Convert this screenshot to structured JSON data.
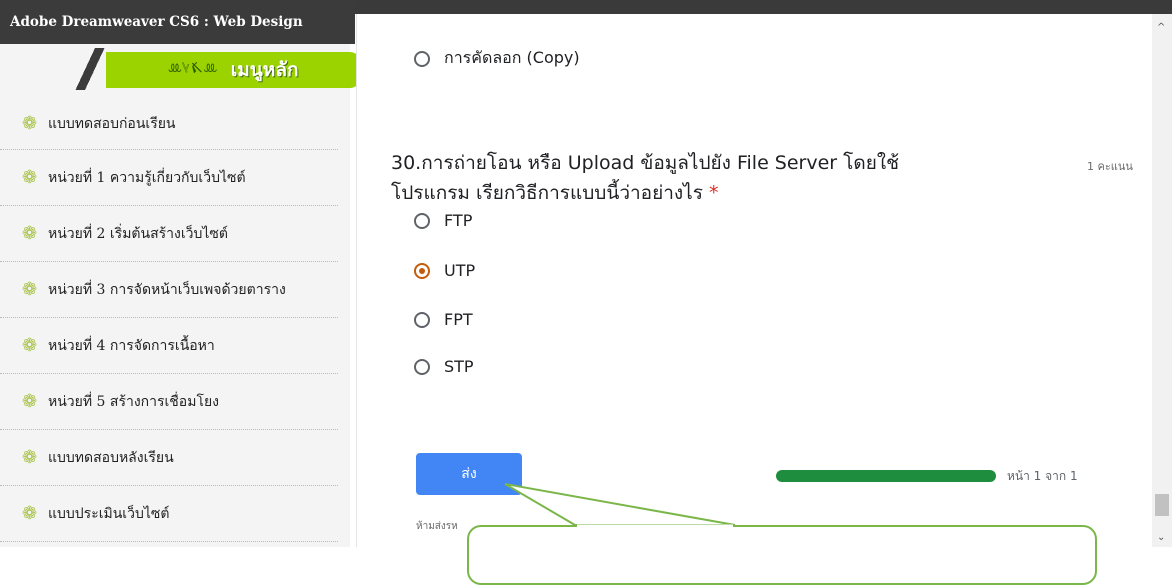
{
  "site_title": "Adobe Dreamweaver CS6 : Web Design",
  "menu": {
    "header_label": "เมนูหลัก",
    "header_decoration": "ꔛ𐇢𐆜ꔛ",
    "items": [
      {
        "label": "แบบทดสอบก่อนเรียน"
      },
      {
        "label": "หน่วยที่ 1 ความรู้เกี่ยวกับเว็บไซต์"
      },
      {
        "label": "หน่วยที่ 2 เริ่มต้นสร้างเว็บไซต์"
      },
      {
        "label": "หน่วยที่ 3 การจัดหน้าเว็บเพจด้วยตาราง"
      },
      {
        "label": "หน่วยที่ 4 การจัดการเนื้อหา"
      },
      {
        "label": "หน่วยที่ 5 สร้างการเชื่อมโยง"
      },
      {
        "label": "แบบทดสอบหลังเรียน"
      },
      {
        "label": "แบบประเมินเว็บไซต์"
      }
    ],
    "item_icon": "flower-icon"
  },
  "form": {
    "previous_option": "การคัดลอก (Copy)",
    "question_line1": "30.การถ่ายโอน หรือ Upload ข้อมูลไปยัง File Server โดยใช้",
    "question_line2": "โปรแกรม เรียกวิธีการแบบนี้ว่าอย่างไร",
    "required_mark": "*",
    "points": "1 คะแนน",
    "options": [
      {
        "label": "FTP",
        "selected": false
      },
      {
        "label": "UTP",
        "selected": true
      },
      {
        "label": "FPT",
        "selected": false
      },
      {
        "label": "STP",
        "selected": false
      }
    ],
    "submit_label": "ส่ง",
    "progress_fraction": 1.0,
    "page_label": "หน้า 1 จาก 1",
    "warning": "ห้ามส่งรห"
  },
  "colors": {
    "accent_blue": "#4285f4",
    "progress_green": "#1e8e3e",
    "radio_selected": "#c45c0c",
    "menu_green": "#9bd300",
    "callout_border": "#7ab648"
  }
}
